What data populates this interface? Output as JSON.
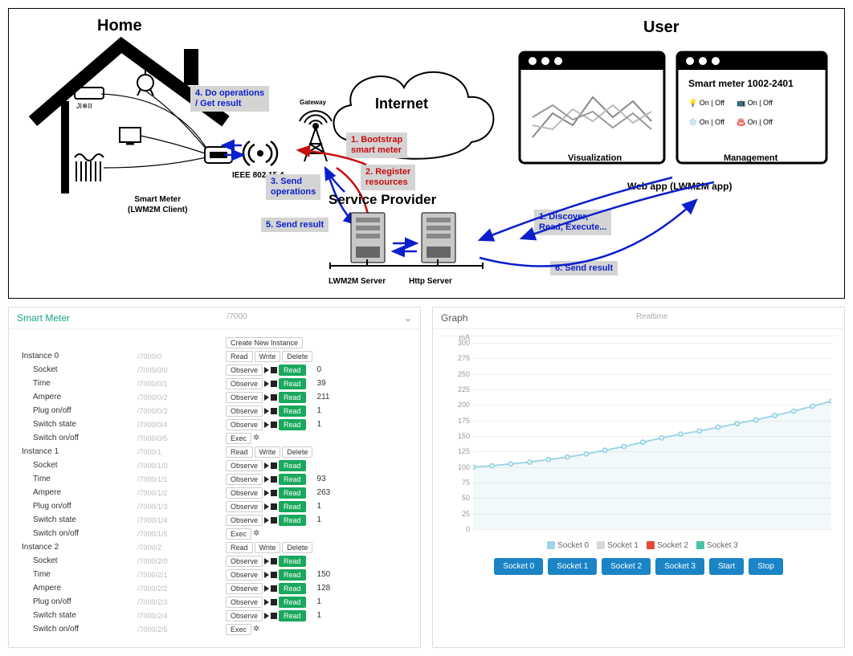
{
  "diagram": {
    "title_home": "Home",
    "title_user": "User",
    "internet": "Internet",
    "gateway": "Gateway",
    "ieee": "IEEE 802.15.4",
    "smart_meter_label": "Smart Meter\n(LWM2M Client)",
    "service_provider": "Service Provider",
    "lwm2m_server": "LWM2M Server",
    "http_server": "Http Server",
    "web_app": "Web app (LWM2M app)",
    "visualization": "Visualization",
    "management": "Management",
    "mgmt_title": "Smart meter 1002-2401",
    "mgmt_onoff": "On | Off",
    "step1": "1. Bootstrap\nsmart meter",
    "step2": "2. Register\nresources",
    "step3": "3. Send\noperations",
    "step4": "4. Do operations\n/ Get result",
    "step5": "5. Send result",
    "step6": "6. Send result",
    "step_user1": "1. Discover,\nRead, Execute..."
  },
  "left_panel": {
    "title": "Smart Meter",
    "root_path": "/7000",
    "create_btn": "Create New Instance",
    "read": "Read",
    "write": "Write",
    "delete": "Delete",
    "observe": "Observe",
    "exec": "Exec",
    "instances": [
      {
        "label": "Instance 0",
        "path": "/7000/0",
        "head_path": "/7000/0/0",
        "rows": [
          {
            "name": "Socket",
            "path": "/7000/0/0",
            "val": "0"
          },
          {
            "name": "Time",
            "path": "/7000/0/1",
            "val": "39"
          },
          {
            "name": "Ampere",
            "path": "/7000/0/2",
            "val": "211"
          },
          {
            "name": "Plug on/off",
            "path": "/7000/0/3",
            "val": "1"
          },
          {
            "name": "Switch state",
            "path": "/7000/0/4",
            "val": "1"
          },
          {
            "name": "Switch on/off",
            "path": "/7000/0/5",
            "val": ""
          }
        ]
      },
      {
        "label": "Instance 1",
        "path": "/7000/1",
        "rows": [
          {
            "name": "Socket",
            "path": "/7000/1/0",
            "val": ""
          },
          {
            "name": "Time",
            "path": "/7000/1/1",
            "val": "93"
          },
          {
            "name": "Ampere",
            "path": "/7000/1/2",
            "val": "263"
          },
          {
            "name": "Plug on/off",
            "path": "/7000/1/3",
            "val": "1"
          },
          {
            "name": "Switch state",
            "path": "/7000/1/4",
            "val": "1"
          },
          {
            "name": "Switch on/off",
            "path": "/7000/1/5",
            "val": ""
          }
        ]
      },
      {
        "label": "Instance 2",
        "path": "/7000/2",
        "rows": [
          {
            "name": "Socket",
            "path": "/7000/2/0",
            "val": ""
          },
          {
            "name": "Time",
            "path": "/7000/2/1",
            "val": "150"
          },
          {
            "name": "Ampere",
            "path": "/7000/2/2",
            "val": "128"
          },
          {
            "name": "Plug on/off",
            "path": "/7000/2/3",
            "val": "1"
          },
          {
            "name": "Switch state",
            "path": "/7000/2/4",
            "val": "1"
          },
          {
            "name": "Switch on/off",
            "path": "/7000/2/5",
            "val": ""
          }
        ]
      }
    ]
  },
  "right_panel": {
    "title": "Graph",
    "subtitle": "Realtime",
    "yunit": "mA",
    "yticks": [
      300,
      275,
      250,
      225,
      200,
      175,
      150,
      125,
      100,
      75,
      50,
      25,
      0
    ],
    "legend": [
      {
        "name": "Socket 0",
        "color": "#9ed6e6"
      },
      {
        "name": "Socket 1",
        "color": "#d8d8d8"
      },
      {
        "name": "Socket 2",
        "color": "#e24b3b"
      },
      {
        "name": "Socket 3",
        "color": "#46c5a7"
      }
    ],
    "buttons": [
      "Socket 0",
      "Socket 1",
      "Socket 2",
      "Socket 3",
      "Start",
      "Stop"
    ]
  },
  "chart_data": {
    "type": "line",
    "title": "Realtime",
    "ylabel": "mA",
    "ylim": [
      0,
      300
    ],
    "x": [
      0,
      1,
      2,
      3,
      4,
      5,
      6,
      7,
      8,
      9,
      10,
      11,
      12,
      13,
      14,
      15,
      16,
      17,
      18,
      19
    ],
    "series": [
      {
        "name": "Socket 0",
        "color": "#9ed6e6",
        "values": [
          100,
          102,
          105,
          108,
          112,
          116,
          121,
          127,
          133,
          140,
          147,
          153,
          158,
          164,
          170,
          176,
          183,
          190,
          198,
          206
        ]
      }
    ]
  }
}
